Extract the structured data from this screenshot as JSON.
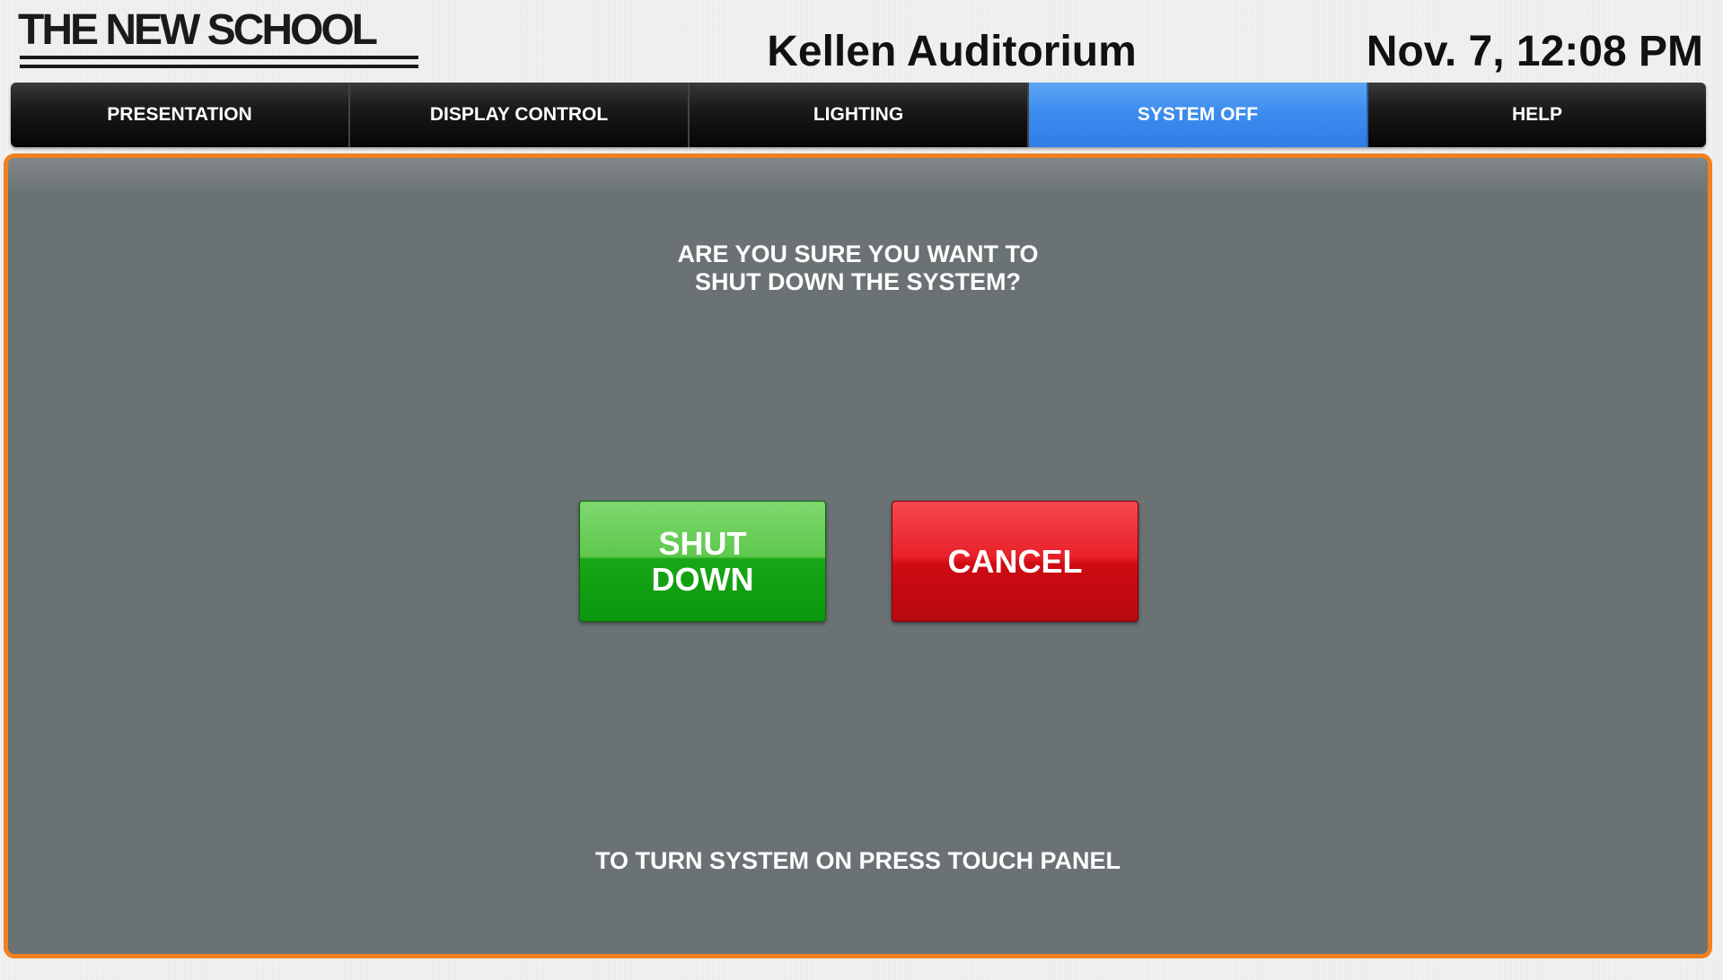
{
  "header": {
    "logo_text": "THE NEW SCHOOL",
    "room_name": "Kellen Auditorium",
    "datetime": "Nov. 7, 12:08 PM"
  },
  "tabs": [
    {
      "label": "PRESENTATION",
      "active": false
    },
    {
      "label": "DISPLAY CONTROL",
      "active": false
    },
    {
      "label": "LIGHTING",
      "active": false
    },
    {
      "label": "SYSTEM OFF",
      "active": true
    },
    {
      "label": "HELP",
      "active": false
    }
  ],
  "dialog": {
    "question_line1": "ARE YOU SURE YOU WANT TO",
    "question_line2": "SHUT DOWN THE SYSTEM?",
    "shutdown_line1": "SHUT",
    "shutdown_line2": "DOWN",
    "cancel_label": "CANCEL",
    "footer_note": "TO TURN SYSTEM ON PRESS TOUCH PANEL"
  },
  "colors": {
    "panel_border": "#f08122",
    "panel_background": "#6b7274",
    "active_tab": "#3d8df0",
    "shutdown_button": "#17a716",
    "cancel_button": "#e9212a"
  }
}
